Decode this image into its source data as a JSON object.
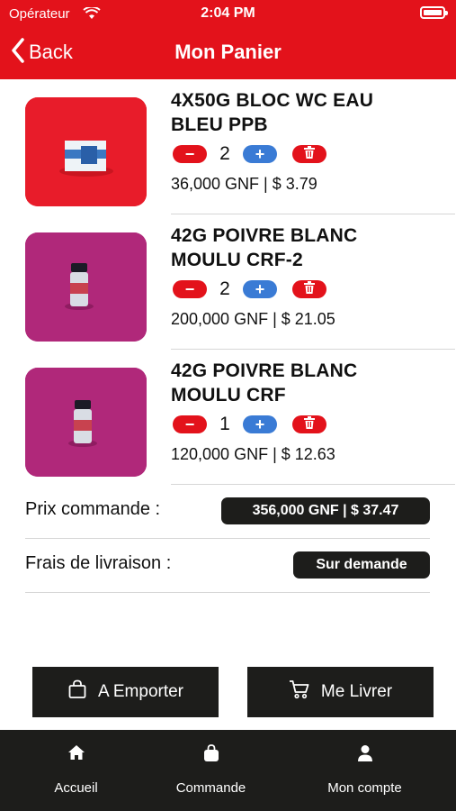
{
  "status_bar": {
    "carrier": "Opérateur",
    "time": "2:04 PM"
  },
  "nav": {
    "back_label": "Back",
    "title": "Mon Panier"
  },
  "cart_items": [
    {
      "name": "4X50G BLOC WC EAU BLEU PPB",
      "quantity": "2",
      "price": "36,000 GNF | $ 3.79",
      "image_bg": "#e81c2a"
    },
    {
      "name": "42G POIVRE BLANC MOULU CRF-2",
      "quantity": "2",
      "price": "200,000 GNF | $ 21.05",
      "image_bg": "#b0287a"
    },
    {
      "name": "42G POIVRE BLANC MOULU CRF",
      "quantity": "1",
      "price": "120,000 GNF | $ 12.63",
      "image_bg": "#b0287a"
    }
  ],
  "controls": {
    "minus": "−",
    "plus": "+"
  },
  "summary": {
    "order_price_label": "Prix commande :",
    "order_price_value": "356,000 GNF | $ 37.47",
    "delivery_label": "Frais de livraison :",
    "delivery_value": "Sur demande"
  },
  "actions": {
    "takeaway_label": "A Emporter",
    "deliver_label": "Me Livrer"
  },
  "tabbar": {
    "items": [
      {
        "label": "Accueil"
      },
      {
        "label": "Commande"
      },
      {
        "label": "Mon compte"
      }
    ]
  },
  "colors": {
    "brand_red": "#e3121b",
    "dark": "#1d1d1b",
    "plus_blue": "#3a7bd5"
  }
}
